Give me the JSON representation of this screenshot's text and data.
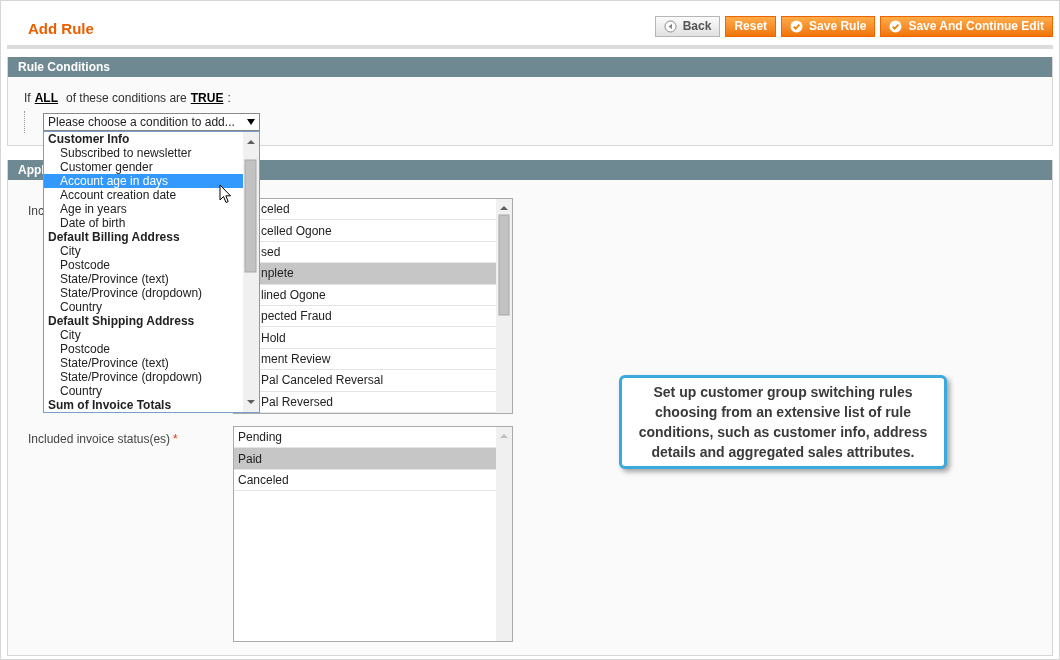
{
  "header": {
    "title": "Add Rule",
    "buttons": [
      {
        "label": "Back",
        "kind": "back"
      },
      {
        "label": "Reset",
        "kind": "plain"
      },
      {
        "label": "Save Rule",
        "kind": "check"
      },
      {
        "label": "Save And Continue Edit",
        "kind": "check"
      }
    ]
  },
  "conditions": {
    "title": "Rule Conditions",
    "prefix": "If",
    "aggregator": "ALL",
    "middle": "of these conditions are",
    "value": "TRUE",
    "suffix": ":",
    "select_placeholder": "Please choose a condition to add...",
    "dropdown": [
      {
        "label": "Customer Info",
        "children": [
          {
            "label": "Subscribed to newsletter",
            "selected": false
          },
          {
            "label": "Customer gender",
            "selected": false
          },
          {
            "label": "Account age in days",
            "selected": true
          },
          {
            "label": "Account creation date",
            "selected": false
          },
          {
            "label": "Age in years",
            "selected": false
          },
          {
            "label": "Date of birth",
            "selected": false
          }
        ]
      },
      {
        "label": "Default Billing Address",
        "children": [
          {
            "label": "City",
            "selected": false
          },
          {
            "label": "Postcode",
            "selected": false
          },
          {
            "label": "State/Province (text)",
            "selected": false
          },
          {
            "label": "State/Province (dropdown)",
            "selected": false
          },
          {
            "label": "Country",
            "selected": false
          }
        ]
      },
      {
        "label": "Default Shipping Address",
        "children": [
          {
            "label": "City",
            "selected": false
          },
          {
            "label": "Postcode",
            "selected": false
          },
          {
            "label": "State/Province (text)",
            "selected": false
          },
          {
            "label": "State/Province (dropdown)",
            "selected": false
          },
          {
            "label": "Country",
            "selected": false
          }
        ]
      },
      {
        "label": "Sum of Invoice Totals"
      }
    ]
  },
  "apply": {
    "title": "Appl",
    "fields": [
      {
        "label": "Inc",
        "options": [
          {
            "label": "celed",
            "selected": false
          },
          {
            "label": "celled Ogone",
            "selected": false
          },
          {
            "label": "sed",
            "selected": false
          },
          {
            "label": "nplete",
            "selected": true
          },
          {
            "label": "lined Ogone",
            "selected": false
          },
          {
            "label": "pected Fraud",
            "selected": false
          },
          {
            "label": "Hold",
            "selected": false
          },
          {
            "label": "ment Review",
            "selected": false
          },
          {
            "label": "Pal Canceled Reversal",
            "selected": false
          },
          {
            "label": "Pal Reversed",
            "selected": false
          }
        ],
        "covered": true
      },
      {
        "label": "Included invoice status(es)",
        "required_mark": "*",
        "options": [
          {
            "label": "Pending",
            "selected": false
          },
          {
            "label": "Paid",
            "selected": true
          },
          {
            "label": "Canceled",
            "selected": false
          }
        ],
        "covered": false
      }
    ]
  },
  "callout": "Set up customer group switching rules choosing from an extensive list of rule conditions, such as customer info, address details and aggregated sales attributes."
}
